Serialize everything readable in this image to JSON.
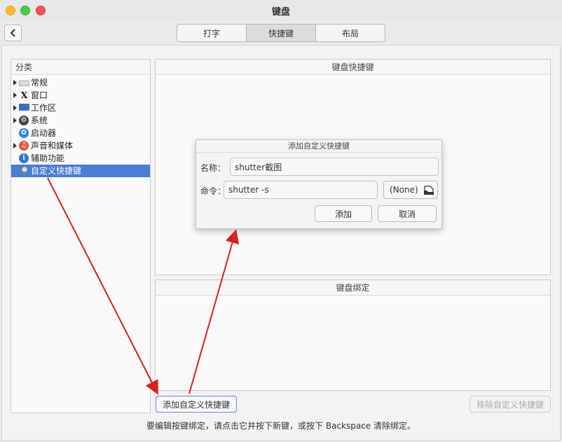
{
  "window": {
    "title": "键盘"
  },
  "tabs": [
    {
      "label": "打字",
      "active": false
    },
    {
      "label": "快捷键",
      "active": true
    },
    {
      "label": "布局",
      "active": false
    }
  ],
  "categories": {
    "header": "分类",
    "items": [
      {
        "label": "常规",
        "icon": "keyboard-icon",
        "expandable": true
      },
      {
        "label": "窗口",
        "icon": "window-x-icon",
        "expandable": true
      },
      {
        "label": "工作区",
        "icon": "workspace-monitor-icon",
        "expandable": true
      },
      {
        "label": "系统",
        "icon": "system-gear-icon",
        "expandable": true
      },
      {
        "label": "启动器",
        "icon": "launcher-icon",
        "expandable": false
      },
      {
        "label": "声音和媒体",
        "icon": "music-note-icon",
        "expandable": true
      },
      {
        "label": "辅助功能",
        "icon": "accessibility-icon",
        "expandable": false
      },
      {
        "label": "自定义快捷键",
        "icon": "custom-shortcut-icon",
        "expandable": false,
        "selected": true
      }
    ]
  },
  "shortcuts_panel": {
    "header": "键盘快捷键"
  },
  "bindings_panel": {
    "header": "键盘绑定"
  },
  "buttons": {
    "add_custom": "添加自定义快捷键",
    "remove_custom": "移除自定义快捷键"
  },
  "hint": "要编辑按键绑定，请点击它并按下新键，或按下 Backspace 清除绑定。",
  "dialog": {
    "title": "添加自定义快捷键",
    "name_label": "名称：",
    "name_value": "shutter截图",
    "command_label": "命令：",
    "command_value": "shutter -s",
    "file_button_label": "(None)",
    "add_label": "添加",
    "cancel_label": "取消"
  },
  "colors": {
    "selection": "#4a7dd3",
    "annotation_arrow": "#d6231c"
  }
}
